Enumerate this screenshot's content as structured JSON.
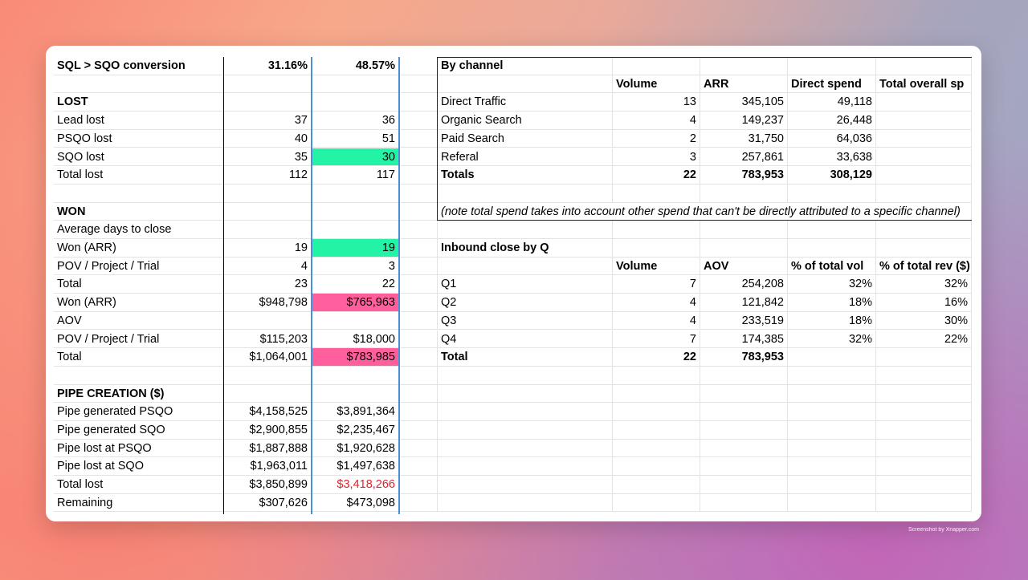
{
  "left_table": [
    {
      "label": "SQL > SQO conversion",
      "a": "31.16%",
      "b": "48.57%",
      "bold": true
    },
    {
      "label": "",
      "a": "",
      "b": ""
    },
    {
      "label": "LOST",
      "a": "",
      "b": "",
      "bold": true
    },
    {
      "label": "Lead lost",
      "a": "37",
      "b": "36"
    },
    {
      "label": "PSQO lost",
      "a": "40",
      "b": "51"
    },
    {
      "label": "SQO lost",
      "a": "35",
      "b": "30",
      "b_hl": "green"
    },
    {
      "label": "Total lost",
      "a": "112",
      "b": "117"
    },
    {
      "label": "",
      "a": "",
      "b": ""
    },
    {
      "label": "WON",
      "a": "",
      "b": "",
      "bold": true
    },
    {
      "label": "Average days to close",
      "a": "",
      "b": ""
    },
    {
      "label": "Won (ARR)",
      "a": "19",
      "b": "19",
      "b_hl": "green"
    },
    {
      "label": "POV / Project / Trial",
      "a": "4",
      "b": "3"
    },
    {
      "label": "Total",
      "a": "23",
      "b": "22"
    },
    {
      "label": "Won (ARR)",
      "a": "$948,798",
      "b": "$765,963",
      "b_hl": "pink"
    },
    {
      "label": "AOV",
      "a": "",
      "b": ""
    },
    {
      "label": "POV / Project / Trial",
      "a": "$115,203",
      "b": "$18,000"
    },
    {
      "label": "Total",
      "a": "$1,064,001",
      "b": "$783,985",
      "b_hl": "pink"
    },
    {
      "label": "",
      "a": "",
      "b": ""
    },
    {
      "label": "PIPE CREATION ($)",
      "a": "",
      "b": "",
      "bold": true
    },
    {
      "label": "Pipe generated PSQO",
      "a": "$4,158,525",
      "b": "$3,891,364"
    },
    {
      "label": "Pipe generated SQO",
      "a": "$2,900,855",
      "b": "$2,235,467"
    },
    {
      "label": "Pipe lost at PSQO",
      "a": "$1,887,888",
      "b": "$1,920,628"
    },
    {
      "label": "Pipe lost at SQO",
      "a": "$1,963,011",
      "b": "$1,497,638"
    },
    {
      "label": "Total lost",
      "a": "$3,850,899",
      "b": "$3,418,266",
      "b_red": true
    },
    {
      "label": "Remaining",
      "a": "$307,626",
      "b": "$473,098"
    }
  ],
  "right_table": [
    {
      "c1": "By channel",
      "c2": "",
      "c3": "",
      "c4": "",
      "c5": "",
      "bold1": true
    },
    {
      "c1": "",
      "c2": "Volume",
      "c3": "ARR",
      "c4": "Direct spend",
      "c5": "Total overall sp",
      "hdr": true
    },
    {
      "c1": "Direct Traffic",
      "c2": "13",
      "c3": "345,105",
      "c4": "49,118",
      "c5": ""
    },
    {
      "c1": "Organic Search",
      "c2": "4",
      "c3": "149,237",
      "c4": "26,448",
      "c5": ""
    },
    {
      "c1": "Paid Search",
      "c2": "2",
      "c3": "31,750",
      "c4": "64,036",
      "c5": ""
    },
    {
      "c1": "Referal",
      "c2": "3",
      "c3": "257,861",
      "c4": "33,638",
      "c5": ""
    },
    {
      "c1": "Totals",
      "c2": "22",
      "c3": "783,953",
      "c4": "308,129",
      "c5": "",
      "allbold": true
    },
    {
      "c1": "",
      "c2": "",
      "c3": "",
      "c4": "",
      "c5": ""
    },
    {
      "note": "(note total spend takes into account other spend that can't be directly attributed to a specific channel)"
    },
    {
      "c1": "",
      "c2": "",
      "c3": "",
      "c4": "",
      "c5": ""
    },
    {
      "c1": "Inbound close by Q",
      "c2": "",
      "c3": "",
      "c4": "",
      "c5": "",
      "bold1": true
    },
    {
      "c1": "",
      "c2": "Volume",
      "c3": "AOV",
      "c4": "% of total vol",
      "c5": "% of total rev ($)",
      "hdr": true
    },
    {
      "c1": "Q1",
      "c2": "7",
      "c3": "254,208",
      "c4": "32%",
      "c5": "32%"
    },
    {
      "c1": "Q2",
      "c2": "4",
      "c3": "121,842",
      "c4": "18%",
      "c5": "16%"
    },
    {
      "c1": "Q3",
      "c2": "4",
      "c3": "233,519",
      "c4": "18%",
      "c5": "30%"
    },
    {
      "c1": "Q4",
      "c2": "7",
      "c3": "174,385",
      "c4": "32%",
      "c5": "22%"
    },
    {
      "c1": "Total",
      "c2": "22",
      "c3": "783,953",
      "c4": "",
      "c5": "",
      "allbold": true
    }
  ],
  "watermark": "Screenshot by Xnapper.com",
  "colors": {
    "green_highlight": "#23f3a5",
    "pink_highlight": "#ff5f9c",
    "red_text": "#e8202a",
    "selection_border": "#4a90d9"
  }
}
